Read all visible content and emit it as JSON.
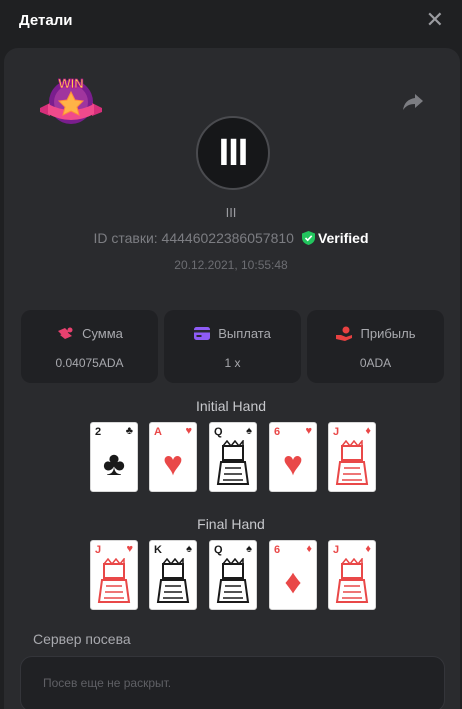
{
  "header": {
    "title": "Детали",
    "close_icon": "close-icon"
  },
  "bet": {
    "badge_text": "WIN",
    "avatar_text": "III",
    "username": "III",
    "id_label": "ID ставки: 44446022386057810",
    "verified": "Verified",
    "date": "20.12.2021, 10:55:48"
  },
  "stats": [
    {
      "label": "Сумма",
      "value": "0.04075ADA",
      "icon": "coins-icon",
      "color": "#e8416f"
    },
    {
      "label": "Выплата",
      "value": "1 x",
      "icon": "card-icon",
      "color": "#8e5cf6"
    },
    {
      "label": "Прибыль",
      "value": "0ADA",
      "icon": "hand-coin-icon",
      "color": "#e84141"
    }
  ],
  "initial_hand": {
    "title": "Initial Hand",
    "cards": [
      {
        "rank": "2",
        "suit": "♣",
        "color": "black"
      },
      {
        "rank": "A",
        "suit": "♥",
        "color": "red"
      },
      {
        "rank": "Q",
        "suit": "♠",
        "color": "black"
      },
      {
        "rank": "6",
        "suit": "♥",
        "color": "red"
      },
      {
        "rank": "J",
        "suit": "♦",
        "color": "red"
      }
    ]
  },
  "final_hand": {
    "title": "Final Hand",
    "cards": [
      {
        "rank": "J",
        "suit": "♥",
        "color": "red"
      },
      {
        "rank": "K",
        "suit": "♠",
        "color": "black"
      },
      {
        "rank": "Q",
        "suit": "♠",
        "color": "black"
      },
      {
        "rank": "6",
        "suit": "♦",
        "color": "red"
      },
      {
        "rank": "J",
        "suit": "♦",
        "color": "red"
      }
    ]
  },
  "seed": {
    "label": "Сервер посева",
    "placeholder": "Посев еще не раскрыт."
  },
  "colors": {
    "accent_green": "#22c55e",
    "panel": "#2a2b2e",
    "bg": "#1f2022"
  }
}
